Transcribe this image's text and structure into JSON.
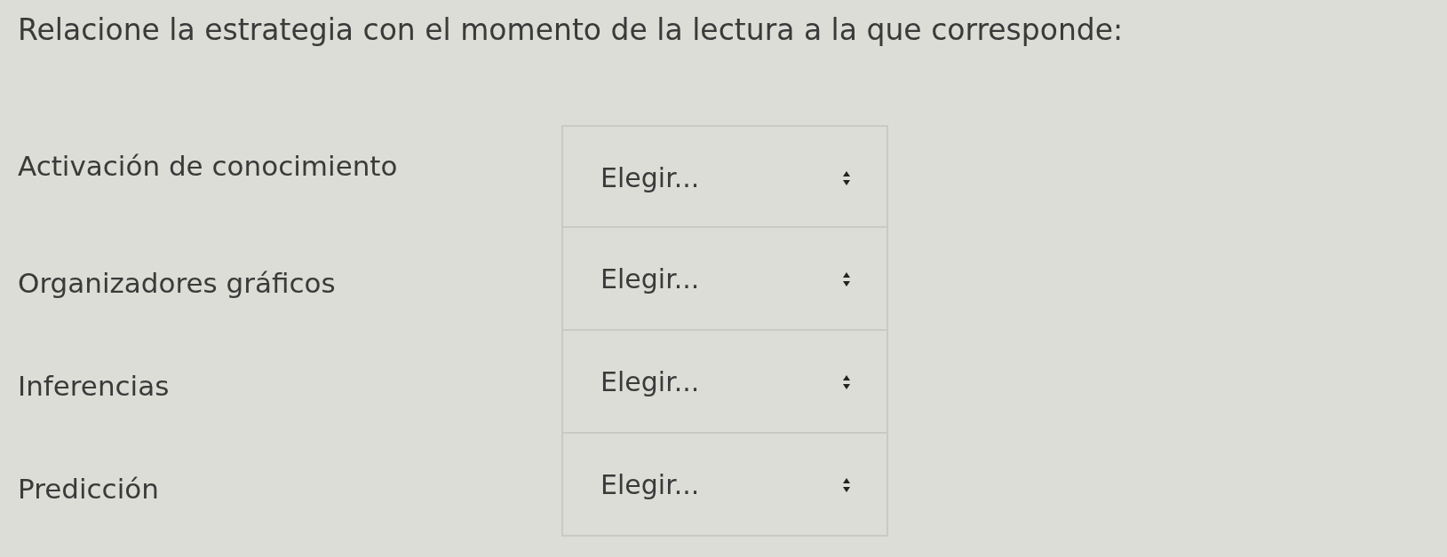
{
  "question": "Relacione la estrategia con el momento de la lectura a la que corresponde:",
  "rows": [
    {
      "label": "Activación de conocimiento",
      "select": {
        "value": "Elegir..."
      }
    },
    {
      "label": "Organizadores gráficos",
      "select": {
        "value": "Elegir..."
      }
    },
    {
      "label": "Inferencias",
      "select": {
        "value": "Elegir..."
      }
    },
    {
      "label": "Predicción",
      "select": {
        "value": "Elegir..."
      }
    }
  ]
}
